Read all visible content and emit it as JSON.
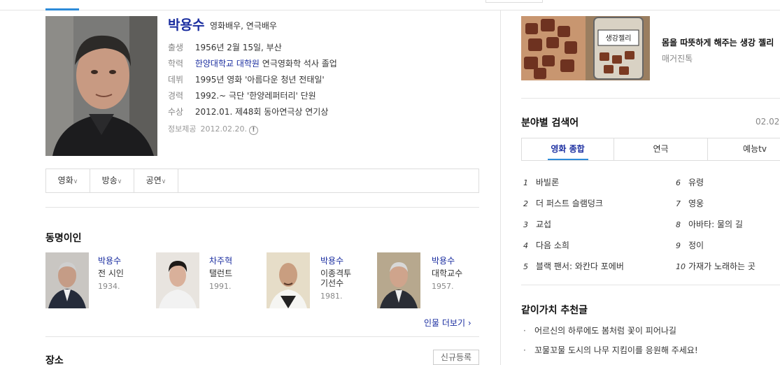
{
  "profile": {
    "name": "박용수",
    "job": "영화배우, 연극배우",
    "rows": [
      {
        "label": "출생",
        "value": "1956년 2월 15일, 부산"
      },
      {
        "label": "학력",
        "link": "한양대학교 대학원",
        "value": "연극영화학 석사 졸업"
      },
      {
        "label": "데뷔",
        "value": "1995년 영화 '아름다운 청년 전태일'"
      },
      {
        "label": "경력",
        "value": "1992.~ 극단 '한양레퍼터리' 단원"
      },
      {
        "label": "수상",
        "value": "2012.01. 제48회 동아연극상 연기상"
      }
    ],
    "source_label": "정보제공",
    "source_date": "2012.02.20.",
    "info_icon": "!"
  },
  "filters": [
    "영화",
    "방송",
    "공연"
  ],
  "chevron": "∨",
  "same_name": {
    "title": "동명이인",
    "people": [
      {
        "name": "박용수",
        "desc": "전 시인",
        "year": "1934."
      },
      {
        "name": "차주혁",
        "desc": "탤런트",
        "year": "1991."
      },
      {
        "name": "박용수",
        "desc": "이종격투\n기선수",
        "year": "1981."
      },
      {
        "name": "박용수",
        "desc": "대학교수",
        "year": "1957."
      }
    ],
    "more_label": "인물 더보기 ›"
  },
  "place": {
    "title": "장소",
    "register_label": "신규등록"
  },
  "ad": {
    "jar_label": "생강젤리",
    "title": "몸을 따뜻하게 해주는 생강 젤리",
    "subtitle": "매거진톡"
  },
  "ranking": {
    "title": "분야별 검색어",
    "date": "02.02.",
    "tabs": [
      "영화 종합",
      "연극",
      "예능tv"
    ],
    "items": [
      {
        "num": "1",
        "text": "바빌론"
      },
      {
        "num": "2",
        "text": "더 퍼스트 슬램덩크"
      },
      {
        "num": "3",
        "text": "교섭"
      },
      {
        "num": "4",
        "text": "다음 소희"
      },
      {
        "num": "5",
        "text": "블랙 팬서: 와칸다 포에버"
      },
      {
        "num": "6",
        "text": "유령"
      },
      {
        "num": "7",
        "text": "영웅"
      },
      {
        "num": "8",
        "text": "아바타: 물의 길"
      },
      {
        "num": "9",
        "text": "정이"
      },
      {
        "num": "10",
        "text": "가재가 노래하는 곳"
      }
    ]
  },
  "recommend": {
    "title": "같이가치 추천글",
    "bullet": "·",
    "items": [
      "어르신의 하루에도 봄처럼 꽃이 피어나길",
      "꼬물꼬물 도시의 나무 지킴이를 응원해 주세요!"
    ]
  }
}
